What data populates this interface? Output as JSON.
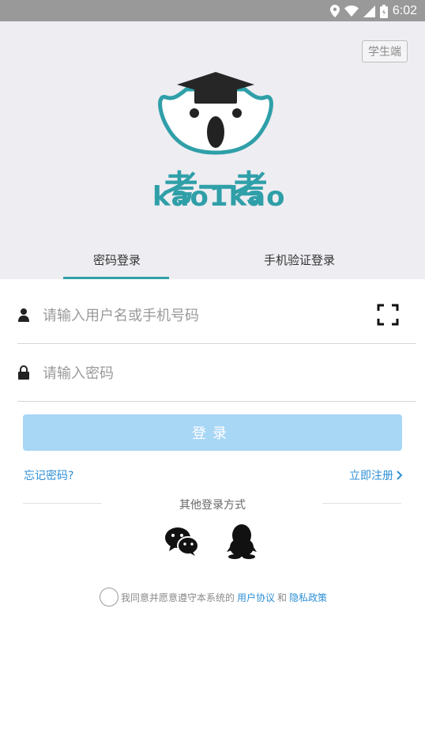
{
  "status": {
    "time": "6:02"
  },
  "header": {
    "student_button": "学生端",
    "logo_cn": "考一考",
    "logo_en": "kao1kao"
  },
  "tabs": [
    {
      "label": "密码登录",
      "active": true
    },
    {
      "label": "手机验证登录",
      "active": false
    }
  ],
  "form": {
    "username_placeholder": "请输入用户名或手机号码",
    "password_placeholder": "请输入密码",
    "login_label": "登录",
    "forgot_label": "忘记密码?",
    "register_label": "立即注册"
  },
  "social": {
    "title": "其他登录方式",
    "icons": [
      "wechat-icon",
      "qq-icon"
    ]
  },
  "agreement": {
    "prefix": "我同意并愿意遵守本系统的",
    "user_agreement": "用户协议",
    "and": "和",
    "privacy_policy": "隐私政策"
  },
  "colors": {
    "accent": "#2f9fa8",
    "link": "#2d8fd6",
    "button": "#a8d6f5",
    "hero_bg": "#eeedf2"
  }
}
